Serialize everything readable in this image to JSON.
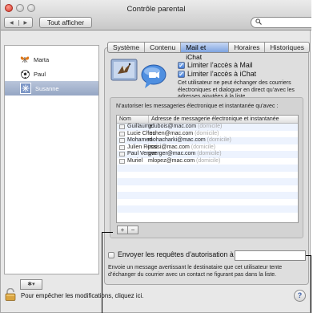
{
  "window": {
    "title": "Contrôle parental"
  },
  "toolbar": {
    "back_glyph": "◀",
    "forward_glyph": "▶",
    "show_all_label": "Tout afficher",
    "search_placeholder": ""
  },
  "users": [
    {
      "name": "Marta",
      "icon": "butterfly-icon",
      "selected": false
    },
    {
      "name": "Paul",
      "icon": "soccer-ball-icon",
      "selected": false
    },
    {
      "name": "Susanne",
      "icon": "snowflake-icon",
      "selected": true
    }
  ],
  "sidebar_action_label": "✱▾",
  "tabs": [
    {
      "label": "Système",
      "active": false
    },
    {
      "label": "Contenu",
      "active": false
    },
    {
      "label": "Mail et iChat",
      "active": true
    },
    {
      "label": "Horaires",
      "active": false
    },
    {
      "label": "Historiques",
      "active": false
    }
  ],
  "mail_ichat": {
    "limit_mail_label": "Limiter l’accès à Mail",
    "limit_mail_checked": true,
    "limit_ichat_label": "Limiter l’accès à iChat",
    "limit_ichat_checked": true,
    "note": "Cet utilisateur ne peut échanger des courriers électroniques et dialoguer en direct qu’avec les adresses ajoutées à la liste.",
    "allow_label": "N’autoriser les messageries électronique et instantanée qu’avec :",
    "columns": [
      "Nom",
      "Adresse de messagerie électronique et instantanée"
    ],
    "contacts": [
      {
        "name": "Guillaume",
        "address": "gdubois@mac.com",
        "kind": "(domicile)"
      },
      {
        "name": "Lucie Chen",
        "address": "luchen@mac.com",
        "kind": "(domicile)"
      },
      {
        "name": "Mohamed",
        "address": "mohacharki@mac.com",
        "kind": "(domicile)"
      },
      {
        "name": "Julien Rossi",
        "address": "jrossi@mac.com",
        "kind": "(domicile)"
      },
      {
        "name": "Paul Verger",
        "address": "pverger@mac.com",
        "kind": "(domicile)"
      },
      {
        "name": "Muriel",
        "address": "mlopez@mac.com",
        "kind": "(domicile)"
      }
    ],
    "add_label": "+",
    "remove_label": "−",
    "request_label": "Envoyer les requêtes d’autorisation à :",
    "request_checked": false,
    "request_value": "",
    "request_note": "Envoie un message avertissant le destinataire que cet utilisateur tente d’échanger du courrier avec un contact ne figurant pas dans la liste."
  },
  "footer": {
    "lock_text": "Pour empêcher les modifications, cliquez ici.",
    "help_label": "?"
  },
  "colors": {
    "selection": "#95a6c4",
    "active_tab": "#7ea4e0",
    "checkbox_blue": "#3f79d6"
  }
}
